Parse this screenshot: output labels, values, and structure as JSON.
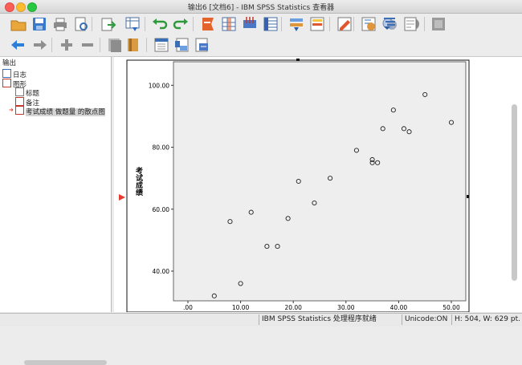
{
  "window": {
    "title": "输出6 [文档6] - IBM SPSS Statistics 查看器"
  },
  "toolbar": {
    "row1": [
      "open-icon",
      "save-icon",
      "print-icon",
      "print-preview-icon",
      "export-icon",
      "goto-data-icon",
      "undo-icon",
      "redo-icon",
      "goto-case-icon",
      "goto-variable-icon",
      "variables-icon",
      "descriptives-icon",
      "split-file-icon",
      "weight-cases-icon",
      "value-labels-icon",
      "use-sets-icon",
      "show-all-variables-icon",
      "designate-window-icon",
      "insert-output-icon",
      "script-icon",
      "unavailable-icon"
    ],
    "row2": [
      "back-icon",
      "forward-icon",
      "expand-icon",
      "collapse-icon",
      "show-icon",
      "hide-icon",
      "insert-heading-icon",
      "insert-title-icon",
      "insert-text-icon"
    ]
  },
  "outline": {
    "root": "输出",
    "items": [
      {
        "label": "日志",
        "icon": "log-icon",
        "level": 1
      },
      {
        "label": "图形",
        "icon": "graph-folder-icon",
        "level": 1
      },
      {
        "label": "标题",
        "icon": "title-icon",
        "level": 2
      },
      {
        "label": "备注",
        "icon": "notes-icon",
        "level": 2
      },
      {
        "label": "考试成绩 做题量 的散点图",
        "icon": "chart-icon",
        "level": 2,
        "selected": true
      }
    ]
  },
  "chart_data": {
    "type": "scatter",
    "ylabel": "考试成绩",
    "xlabel": "",
    "x_ticks": [
      ".00",
      "10.00",
      "20.00",
      "30.00",
      "40.00",
      "50.00"
    ],
    "y_ticks": [
      "40.00",
      "60.00",
      "80.00",
      "100.00"
    ],
    "xlim": [
      0,
      50
    ],
    "ylim": [
      33,
      105
    ],
    "grid": false,
    "points": [
      {
        "x": 5,
        "y": 32
      },
      {
        "x": 8,
        "y": 56
      },
      {
        "x": 10,
        "y": 36
      },
      {
        "x": 12,
        "y": 59
      },
      {
        "x": 15,
        "y": 48
      },
      {
        "x": 17,
        "y": 48
      },
      {
        "x": 19,
        "y": 57
      },
      {
        "x": 21,
        "y": 69
      },
      {
        "x": 24,
        "y": 62
      },
      {
        "x": 27,
        "y": 70
      },
      {
        "x": 32,
        "y": 79
      },
      {
        "x": 35,
        "y": 76
      },
      {
        "x": 35,
        "y": 75
      },
      {
        "x": 36,
        "y": 75
      },
      {
        "x": 37,
        "y": 86
      },
      {
        "x": 39,
        "y": 92
      },
      {
        "x": 41,
        "y": 86
      },
      {
        "x": 42,
        "y": 85
      },
      {
        "x": 45,
        "y": 97
      },
      {
        "x": 50,
        "y": 88
      }
    ],
    "colors": {
      "plot_bg": "#eeeeee",
      "marker": "#222222"
    }
  },
  "status": {
    "processor": "IBM SPSS Statistics 处理程序就绪",
    "unicode": "Unicode:ON",
    "size": "H: 504, W: 629 pt."
  }
}
